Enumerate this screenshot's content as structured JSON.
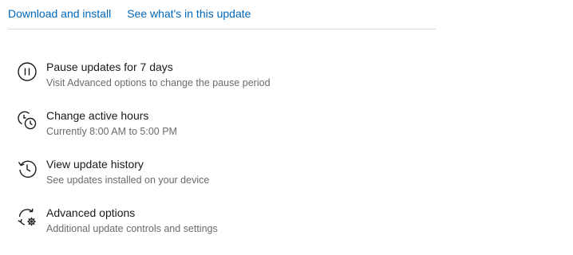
{
  "header_links": {
    "download_install": "Download and install",
    "whats_new": "See what's in this update"
  },
  "options": [
    {
      "icon": "pause-icon",
      "title": "Pause updates for 7 days",
      "subtitle": "Visit Advanced options to change the pause period"
    },
    {
      "icon": "active-hours-icon",
      "title": "Change active hours",
      "subtitle": "Currently 8:00 AM to 5:00 PM"
    },
    {
      "icon": "history-icon",
      "title": "View update history",
      "subtitle": "See updates installed on your device"
    },
    {
      "icon": "advanced-options-icon",
      "title": "Advanced options",
      "subtitle": "Additional update controls and settings"
    }
  ],
  "colors": {
    "link": "#0067b8",
    "title": "#1a1a1a",
    "subtitle": "#6b6b6b",
    "divider": "#d9d9d9"
  }
}
